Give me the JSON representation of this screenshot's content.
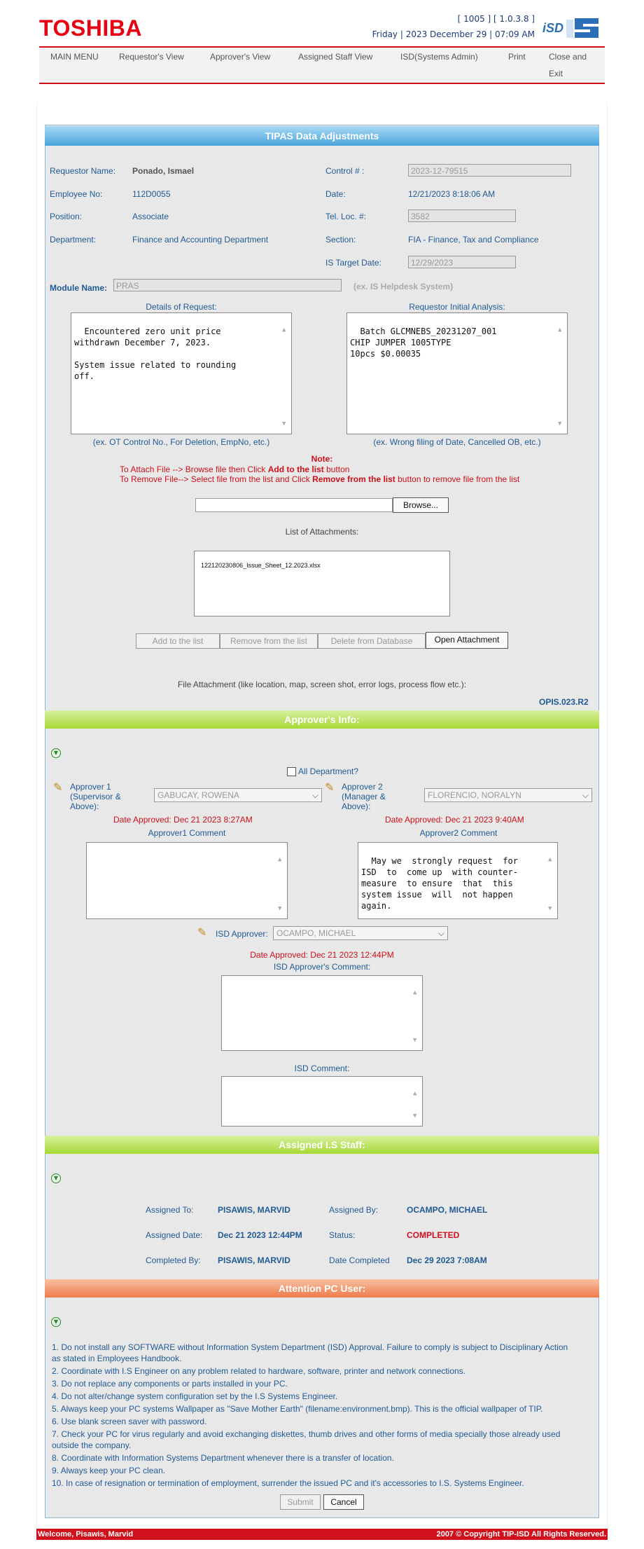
{
  "header": {
    "logo": "TOSHIBA",
    "version": "[ 1005 ] [ 1.0.3.8 ]",
    "datetime": "Friday | 2023 December 29 | 07:09 AM",
    "isd_logo": "iSD"
  },
  "menu": [
    "MAIN MENU",
    "Requestor's View",
    "Approver's View",
    "Assigned Staff View",
    "ISD(Systems Admin)",
    "Print",
    "Close and",
    "Exit"
  ],
  "form": {
    "title": "TIPAS Data Adjustments",
    "requestor_name_label": "Requestor Name:",
    "requestor_name": "Ponado, Ismael",
    "control_label": "Control # :",
    "control": "2023-12-79515",
    "employee_no_label": "Employee No:",
    "employee_no": "112D0055",
    "date_label": "Date:",
    "date": "12/21/2023 8:18:06 AM",
    "position_label": "Position:",
    "position": "Associate",
    "tel_label": "Tel. Loc. #:",
    "tel": "3582",
    "department_label": "Department:",
    "department": "Finance and Accounting Department",
    "section_label": "Section:",
    "section": "FIA - Finance, Tax and Compliance",
    "target_label": "IS Target Date:",
    "target": "12/29/2023",
    "module_label": "Module Name:",
    "module": "PRAS",
    "module_hint": "(ex. IS Helpdesk System)",
    "details_label": "Details of Request:",
    "details": "Encountered zero unit price\nwithdrawn December 7, 2023.\n\nSystem issue related to rounding\noff.",
    "details_hint": "(ex. OT Control No., For Deletion, EmpNo, etc.)",
    "analysis_label": "Requestor Initial Analysis:",
    "analysis": "Batch GLCMNEBS_20231207_001\nCHIP JUMPER 1005TYPE\n10pcs $0.00035",
    "analysis_hint": "(ex. Wrong filing of Date, Cancelled OB, etc.)"
  },
  "attach": {
    "note_title": "Note:",
    "note1_a": "To Attach File --> Browse file then Click ",
    "note1_b": "Add to the list",
    "note1_c": "  button",
    "note2_a": "To Remove File--> Select file from the list and Click ",
    "note2_b": "Remove from the list",
    "note2_c": " button to remove file from the list",
    "browse": "Browse...",
    "list_label": "List of Attachments:",
    "file": "122120230806_Issue_Sheet_12.2023.xlsx",
    "btn_add": "Add to the list",
    "btn_remove": "Remove from the list",
    "btn_delete": "Delete from Database",
    "btn_open": "Open Attachment",
    "file_attach_label": "File Attachment (like location, map, screen shot, error logs, process flow etc.):",
    "form_code": "OPIS.023.R2"
  },
  "approver": {
    "title": "Approver's Info:",
    "all_dept": "All Department?",
    "a1_label": "Approver 1\n(Supervisor &\nAbove):",
    "a1": "GABUCAY, ROWENA",
    "a1_date": "Date Approved: Dec 21 2023 8:27AM",
    "a1_comment_label": "Approver1 Comment",
    "a2_label": "Approver 2\n(Manager &\nAbove):",
    "a2": "FLORENCIO, NORALYN",
    "a2_date": "Date Approved: Dec 21 2023 9:40AM",
    "a2_comment_label": "Approver2 Comment",
    "a2_comment": "May we  strongly request  for\nISD  to  come up  with counter-\nmeasure  to ensure  that  this\nsystem issue  will  not happen\nagain.",
    "isd_label": "ISD Approver:",
    "isd": "OCAMPO, MICHAEL",
    "isd_date": "Date Approved: Dec 21 2023 12:44PM",
    "isd_comment_label": "ISD Approver's Comment:",
    "isd_comment2_label": "ISD Comment:"
  },
  "staff": {
    "title": "Assigned I.S Staff:",
    "assigned_to_label": "Assigned To:",
    "assigned_to": "PISAWIS, MARVID",
    "assigned_by_label": "Assigned By:",
    "assigned_by": "OCAMPO, MICHAEL",
    "assigned_date_label": "Assigned Date:",
    "assigned_date": "Dec 21 2023 12:44PM",
    "status_label": "Status:",
    "status": "COMPLETED",
    "completed_by_label": "Completed By:",
    "completed_by": "PISAWIS, MARVID",
    "date_completed_label": "Date Completed",
    "date_completed": "Dec 29 2023 7:08AM"
  },
  "attention": {
    "title": "Attention PC User:",
    "rules": [
      "1. Do not install any SOFTWARE without Information System Department (ISD) Approval. Failure to comply is subject to Disciplinary Action",
      "as stated in Employees Handbook.",
      "2. Coordinate with I.S Engineer on any problem related to hardware, software, printer and network connections.",
      "3. Do not replace any components or parts installed in your PC.",
      "4. Do not alter/change system configuration set by the I.S Systems Engineer.",
      "5. Always keep your PC systems Wallpaper as \"Save Mother Earth\" (filename:environment.bmp). This is the official wallpaper of TIP.",
      "6. Use blank screen saver with password.",
      "7. Check your PC for virus regularly and avoid exchanging diskettes, thumb drives and other forms of media specially those already used",
      "outside the company.",
      "8. Coordinate with Information Systems Department whenever there is a transfer of location.",
      "9. Always keep your PC clean.",
      "10. In case of resignation or termination of employment, surrender the issued PC and it's accessories to I.S. Systems Engineer."
    ],
    "submit": "Submit",
    "cancel": "Cancel"
  },
  "footer": {
    "welcome": "Welcome, Pisawis, Marvid",
    "copyright": "2007 © Copyright TIP-ISD All Rights Reserved."
  }
}
